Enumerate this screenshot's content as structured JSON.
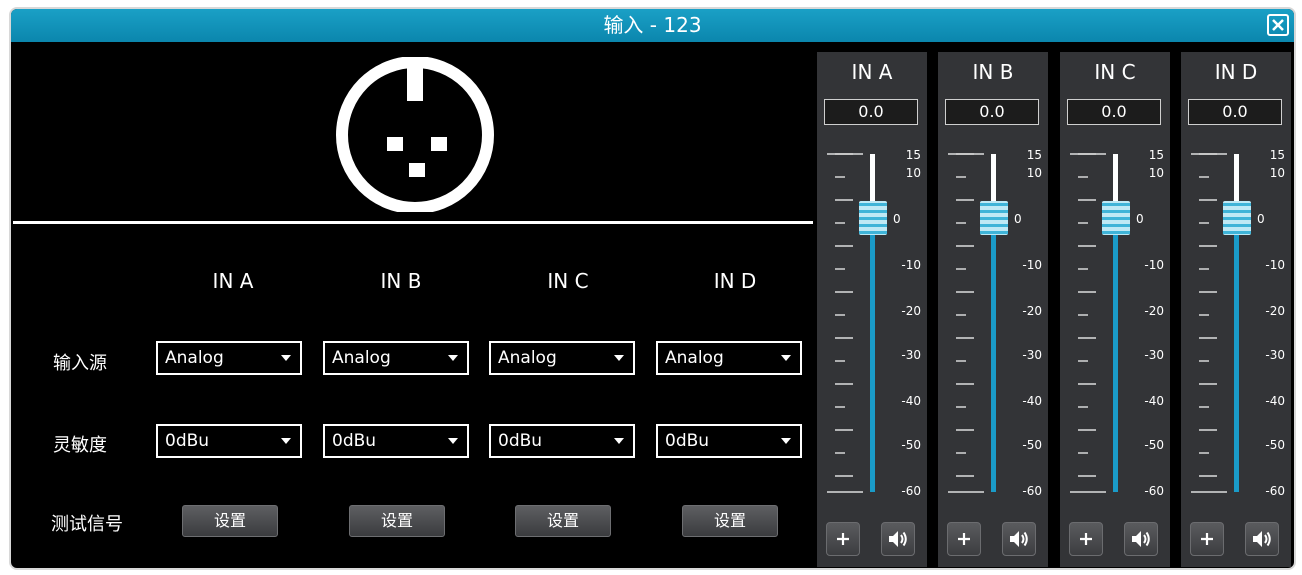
{
  "window": {
    "title": "输入 - 123"
  },
  "channels": [
    "IN A",
    "IN B",
    "IN C",
    "IN D"
  ],
  "rows": {
    "source_label": "输入源",
    "sensitivity_label": "灵敏度",
    "test_label": "测试信号"
  },
  "sources": [
    "Analog",
    "Analog",
    "Analog",
    "Analog"
  ],
  "sensitivities": [
    "0dBu",
    "0dBu",
    "0dBu",
    "0dBu"
  ],
  "set_label": "设置",
  "strips": [
    {
      "name": "IN A",
      "value": "0.0"
    },
    {
      "name": "IN B",
      "value": "0.0"
    },
    {
      "name": "IN C",
      "value": "0.0"
    },
    {
      "name": "IN D",
      "value": "0.0"
    }
  ],
  "scale": [
    "15",
    "10",
    "0",
    "-10",
    "-20",
    "-30",
    "-40",
    "-50",
    "-60"
  ],
  "fader_level_db": 0,
  "icons": {
    "close": "close-icon",
    "connector": "xlr-connector-icon",
    "add": "plus-icon",
    "mute": "speaker-icon"
  },
  "colors": {
    "titlebar": "#1097bf",
    "fader_track": "#1a9bc8",
    "panel": "#333437"
  }
}
